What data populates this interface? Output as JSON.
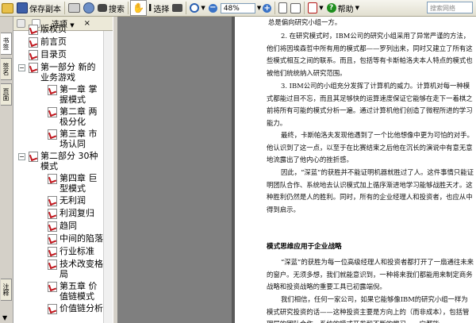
{
  "toolbar": {
    "save_copy": "保存副本",
    "search": "搜索",
    "select": "选择",
    "zoom": "48%",
    "help": "帮助",
    "search_placeholder": "搜索网络"
  },
  "left_tabs": [
    "书签",
    "签名",
    "页面",
    "注释"
  ],
  "bookmarks_panel": {
    "options_label": "选项",
    "items": [
      {
        "label": "版权页",
        "level": 0,
        "expander": ""
      },
      {
        "label": "前言页",
        "level": 0,
        "expander": ""
      },
      {
        "label": "目录页",
        "level": 0,
        "expander": ""
      },
      {
        "label": "第一部分 新的业务游戏",
        "level": 0,
        "expander": "−"
      },
      {
        "label": "第一章 掌握模式",
        "level": 1,
        "expander": ""
      },
      {
        "label": "第二章 两极分化",
        "level": 1,
        "expander": ""
      },
      {
        "label": "第三章 市场认同",
        "level": 1,
        "expander": ""
      },
      {
        "label": "第二部分 30种模式",
        "level": 0,
        "expander": "−"
      },
      {
        "label": "第四章 巨型模式",
        "level": 1,
        "expander": ""
      },
      {
        "label": "无利润",
        "level": 1,
        "expander": ""
      },
      {
        "label": "利润复归",
        "level": 1,
        "expander": ""
      },
      {
        "label": "趋同",
        "level": 1,
        "expander": ""
      },
      {
        "label": "中间的陷落",
        "level": 1,
        "expander": ""
      },
      {
        "label": "行业标准",
        "level": 1,
        "expander": ""
      },
      {
        "label": "技术改变格局",
        "level": 1,
        "expander": ""
      },
      {
        "label": "第五章 价值链模式",
        "level": 1,
        "expander": ""
      },
      {
        "label": "价值链分析",
        "level": 1,
        "expander": ""
      }
    ]
  },
  "document": {
    "line1": "总是偏向研究小组一方。",
    "p2": "2. 在研究模式时，IBM公司的研究小组采用了异常严谨的方法，他们将因埃森哲中所有用的模式都——罗列出来，同时又建立了所有这些模式相互之间的联系。而且，包括等有卡斯帕洛夫本人特点的模式也被他们统统纳入研究范围。",
    "p3": "3. IBM公司的小组充分发挥了计算机的威力。计算机对每一种模式都能过目不忘，而且其足够快的运算速度保证它能够在走下一着棋之前将所有可能的模式分析一遍。通过计算机他们创造了微程所进的学习能力。",
    "p4": "最终，卡斯帕洛夫发现他遇到了一个比他想像中更为可怕的对手。他认识到了这一点，以至于在比赛结束之后他在沉长的演说中有意无意地流露出了他内心的挫折感。",
    "p5": "因此，“深蓝”的获胜并不能证明机器就胜过了人。这件事情只能证明团队合作、系统地去认识模式加上循序渐进地学习能够战胜天才。这种胜利仍然是人的胜利。同时，所有的企业经理人和投资者，也应从中得到启示。",
    "heading": "模式思维应用于企业战略",
    "p6": "“深蓝”的获胜为每一位高级经理人和投资者都打开了一扇通往未来的窗户。无须多想，我们就能意识到，一种将来我们都能用来制定商务战略和投资战略的重要工具已初露端倪。",
    "p7": "我们相信，任何一家公司，如果它能够像IBM的研究小组一样为模式研究投资的话——这种投资主要是方向上的（而非成本），包括管理层的团队合作、系统的模式开发和不断的学习——它都能"
  }
}
